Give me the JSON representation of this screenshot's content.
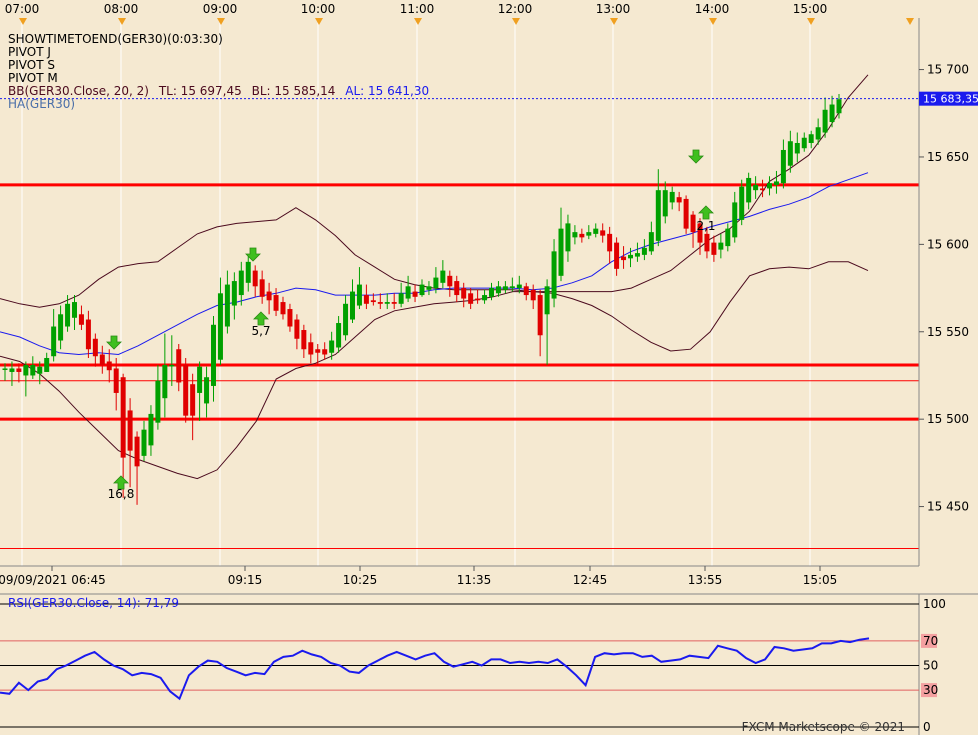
{
  "colors": {
    "background": "#f5e9d1",
    "bull": "#00a000",
    "bear": "#e00000",
    "bb_band": "#4b0a1e",
    "bb_mid": "#1a1aee",
    "pivot": "#ff0000",
    "rsi_line": "#1a1aee",
    "price_tag": "#1a1aee",
    "grid_time": "#ffffff",
    "arrow_green": "#3fbf1f"
  },
  "info_lines": [
    "SHOWTIMETOEND(GER30)(0:03:30)",
    "PIVOT J",
    "PIVOT S",
    "PIVOT M"
  ],
  "bb_legend": {
    "prefix": "BB(GER30.Close, 20, 2)",
    "tl_label": "TL: 15 697,45",
    "bl_label": "BL: 15 585,14",
    "al_label": "AL: 15 641,30"
  },
  "ha_label": "HA(GER30)",
  "last_price_label": "15 683,35",
  "watermark": "FXCM Marketscope © 2021",
  "chart_data": [
    {
      "type": "candlestick",
      "symbol": "GER30",
      "top_time_labels": [
        "07:00",
        "08:00",
        "09:00",
        "10:00",
        "11:00",
        "12:00",
        "13:00",
        "14:00",
        "15:00"
      ],
      "bottom_time_labels": [
        "09/09/2021 06:45",
        "09:15",
        "10:25",
        "11:35",
        "12:45",
        "13:55",
        "15:05"
      ],
      "y_ticks": [
        15700,
        15650,
        15600,
        15550,
        15500,
        15450
      ],
      "y_tick_labels": [
        "15 700",
        "15 650",
        "15 600",
        "15 550",
        "15 500",
        "15 450"
      ],
      "ylim": [
        15416.0,
        15729.5
      ],
      "last_price": 15683.35,
      "candles": [
        {
          "o": 15529,
          "c": 15529,
          "h": 15532,
          "l": 15522
        },
        {
          "o": 15527,
          "c": 15529,
          "h": 15533,
          "l": 15519
        },
        {
          "o": 15529,
          "c": 15527,
          "h": 15532,
          "l": 15521
        },
        {
          "o": 15525,
          "c": 15531,
          "h": 15533,
          "l": 15513
        },
        {
          "o": 15525,
          "c": 15531,
          "h": 15536,
          "l": 15523
        },
        {
          "o": 15526,
          "c": 15530,
          "h": 15533,
          "l": 15520
        },
        {
          "o": 15527,
          "c": 15535,
          "h": 15538,
          "l": 15527
        },
        {
          "o": 15536,
          "c": 15553,
          "h": 15563,
          "l": 15533
        },
        {
          "o": 15545,
          "c": 15560,
          "h": 15565,
          "l": 15540
        },
        {
          "o": 15553,
          "c": 15566,
          "h": 15571,
          "l": 15550
        },
        {
          "o": 15558,
          "c": 15567,
          "h": 15571,
          "l": 15551
        },
        {
          "o": 15560,
          "c": 15554,
          "h": 15565,
          "l": 15551
        },
        {
          "o": 15557,
          "c": 15540,
          "h": 15562,
          "l": 15535
        },
        {
          "o": 15546,
          "c": 15536,
          "h": 15549,
          "l": 15530
        },
        {
          "o": 15537,
          "c": 15531,
          "h": 15542,
          "l": 15526
        },
        {
          "o": 15533,
          "c": 15528,
          "h": 15540,
          "l": 15521
        },
        {
          "o": 15529,
          "c": 15515,
          "h": 15535,
          "l": 15505
        },
        {
          "o": 15524,
          "c": 15478,
          "h": 15526,
          "l": 15455
        },
        {
          "o": 15505,
          "c": 15482,
          "h": 15512,
          "l": 15461
        },
        {
          "o": 15490,
          "c": 15473,
          "h": 15493,
          "l": 15451
        },
        {
          "o": 15479,
          "c": 15494,
          "h": 15499,
          "l": 15476
        },
        {
          "o": 15485,
          "c": 15503,
          "h": 15508,
          "l": 15479
        },
        {
          "o": 15498,
          "c": 15522,
          "h": 15531,
          "l": 15494
        },
        {
          "o": 15512,
          "c": 15531,
          "h": 15549,
          "l": 15501
        },
        {
          "o": 15531,
          "c": 15531,
          "h": 15548,
          "l": 15519
        },
        {
          "o": 15540,
          "c": 15521,
          "h": 15543,
          "l": 15516
        },
        {
          "o": 15531,
          "c": 15502,
          "h": 15535,
          "l": 15498
        },
        {
          "o": 15520,
          "c": 15502,
          "h": 15526,
          "l": 15488
        },
        {
          "o": 15515,
          "c": 15530,
          "h": 15533,
          "l": 15499
        },
        {
          "o": 15509,
          "c": 15524,
          "h": 15530,
          "l": 15501
        },
        {
          "o": 15519,
          "c": 15554,
          "h": 15559,
          "l": 15510
        },
        {
          "o": 15534,
          "c": 15572,
          "h": 15581,
          "l": 15531
        },
        {
          "o": 15553,
          "c": 15577,
          "h": 15585,
          "l": 15549
        },
        {
          "o": 15565,
          "c": 15579,
          "h": 15584,
          "l": 15557
        },
        {
          "o": 15571,
          "c": 15585,
          "h": 15590,
          "l": 15565
        },
        {
          "o": 15578,
          "c": 15590,
          "h": 15594,
          "l": 15573
        },
        {
          "o": 15585,
          "c": 15576,
          "h": 15588,
          "l": 15570
        },
        {
          "o": 15580,
          "c": 15570,
          "h": 15585,
          "l": 15566
        },
        {
          "o": 15573,
          "c": 15568,
          "h": 15578,
          "l": 15560
        },
        {
          "o": 15571,
          "c": 15562,
          "h": 15575,
          "l": 15559
        },
        {
          "o": 15567,
          "c": 15560,
          "h": 15570,
          "l": 15557
        },
        {
          "o": 15563,
          "c": 15553,
          "h": 15566,
          "l": 15550
        },
        {
          "o": 15557,
          "c": 15546,
          "h": 15560,
          "l": 15540
        },
        {
          "o": 15551,
          "c": 15540,
          "h": 15554,
          "l": 15535
        },
        {
          "o": 15544,
          "c": 15537,
          "h": 15549,
          "l": 15532
        },
        {
          "o": 15540,
          "c": 15538,
          "h": 15543,
          "l": 15531
        },
        {
          "o": 15540,
          "c": 15537,
          "h": 15544,
          "l": 15534
        },
        {
          "o": 15538,
          "c": 15545,
          "h": 15550,
          "l": 15534
        },
        {
          "o": 15541,
          "c": 15555,
          "h": 15559,
          "l": 15538
        },
        {
          "o": 15548,
          "c": 15566,
          "h": 15571,
          "l": 15545
        },
        {
          "o": 15557,
          "c": 15573,
          "h": 15580,
          "l": 15555
        },
        {
          "o": 15565,
          "c": 15577,
          "h": 15587,
          "l": 15563
        },
        {
          "o": 15571,
          "c": 15566,
          "h": 15577,
          "l": 15563
        },
        {
          "o": 15568,
          "c": 15567,
          "h": 15572,
          "l": 15565
        },
        {
          "o": 15567,
          "c": 15566,
          "h": 15572,
          "l": 15563
        },
        {
          "o": 15566,
          "c": 15567,
          "h": 15572,
          "l": 15563
        },
        {
          "o": 15567,
          "c": 15566,
          "h": 15572,
          "l": 15563
        },
        {
          "o": 15566,
          "c": 15572,
          "h": 15578,
          "l": 15564
        },
        {
          "o": 15569,
          "c": 15576,
          "h": 15582,
          "l": 15567
        },
        {
          "o": 15573,
          "c": 15570,
          "h": 15577,
          "l": 15567
        },
        {
          "o": 15571,
          "c": 15577,
          "h": 15580,
          "l": 15570
        },
        {
          "o": 15574,
          "c": 15576,
          "h": 15579,
          "l": 15571
        },
        {
          "o": 15575,
          "c": 15581,
          "h": 15587,
          "l": 15572
        },
        {
          "o": 15578,
          "c": 15585,
          "h": 15591,
          "l": 15575
        },
        {
          "o": 15582,
          "c": 15576,
          "h": 15585,
          "l": 15570
        },
        {
          "o": 15579,
          "c": 15571,
          "h": 15582,
          "l": 15567
        },
        {
          "o": 15575,
          "c": 15569,
          "h": 15578,
          "l": 15564
        },
        {
          "o": 15572,
          "c": 15566,
          "h": 15575,
          "l": 15563
        },
        {
          "o": 15569,
          "c": 15568,
          "h": 15574,
          "l": 15566
        },
        {
          "o": 15568,
          "c": 15571,
          "h": 15574,
          "l": 15566
        },
        {
          "o": 15570,
          "c": 15575,
          "h": 15578,
          "l": 15568
        },
        {
          "o": 15572,
          "c": 15576,
          "h": 15579,
          "l": 15570
        },
        {
          "o": 15574,
          "c": 15576,
          "h": 15579,
          "l": 15572
        },
        {
          "o": 15575,
          "c": 15576,
          "h": 15581,
          "l": 15573
        },
        {
          "o": 15575,
          "c": 15577,
          "h": 15582,
          "l": 15572
        },
        {
          "o": 15576,
          "c": 15571,
          "h": 15578,
          "l": 15568
        },
        {
          "o": 15574,
          "c": 15568,
          "h": 15577,
          "l": 15563
        },
        {
          "o": 15571,
          "c": 15548,
          "h": 15574,
          "l": 15536
        },
        {
          "o": 15560,
          "c": 15576,
          "h": 15580,
          "l": 15531
        },
        {
          "o": 15569,
          "c": 15596,
          "h": 15603,
          "l": 15564
        },
        {
          "o": 15582,
          "c": 15609,
          "h": 15621,
          "l": 15579
        },
        {
          "o": 15596,
          "c": 15612,
          "h": 15617,
          "l": 15590
        },
        {
          "o": 15604,
          "c": 15607,
          "h": 15611,
          "l": 15600
        },
        {
          "o": 15606,
          "c": 15604,
          "h": 15609,
          "l": 15601
        },
        {
          "o": 15605,
          "c": 15607,
          "h": 15611,
          "l": 15603
        },
        {
          "o": 15606,
          "c": 15609,
          "h": 15612,
          "l": 15604
        },
        {
          "o": 15608,
          "c": 15605,
          "h": 15612,
          "l": 15601
        },
        {
          "o": 15606,
          "c": 15596,
          "h": 15610,
          "l": 15589
        },
        {
          "o": 15601,
          "c": 15586,
          "h": 15604,
          "l": 15582
        },
        {
          "o": 15593,
          "c": 15591,
          "h": 15599,
          "l": 15586
        },
        {
          "o": 15592,
          "c": 15594,
          "h": 15598,
          "l": 15587
        },
        {
          "o": 15593,
          "c": 15595,
          "h": 15601,
          "l": 15590
        },
        {
          "o": 15594,
          "c": 15598,
          "h": 15603,
          "l": 15591
        },
        {
          "o": 15596,
          "c": 15607,
          "h": 15613,
          "l": 15594
        },
        {
          "o": 15602,
          "c": 15631,
          "h": 15643,
          "l": 15599
        },
        {
          "o": 15616,
          "c": 15631,
          "h": 15636,
          "l": 15612
        },
        {
          "o": 15624,
          "c": 15630,
          "h": 15633,
          "l": 15620
        },
        {
          "o": 15627,
          "c": 15624,
          "h": 15630,
          "l": 15619
        },
        {
          "o": 15626,
          "c": 15609,
          "h": 15628,
          "l": 15606
        },
        {
          "o": 15617,
          "c": 15607,
          "h": 15619,
          "l": 15598
        },
        {
          "o": 15612,
          "c": 15601,
          "h": 15615,
          "l": 15594
        },
        {
          "o": 15606,
          "c": 15596,
          "h": 15610,
          "l": 15592
        },
        {
          "o": 15601,
          "c": 15594,
          "h": 15605,
          "l": 15590
        },
        {
          "o": 15597,
          "c": 15601,
          "h": 15606,
          "l": 15592
        },
        {
          "o": 15599,
          "c": 15609,
          "h": 15612,
          "l": 15596
        },
        {
          "o": 15604,
          "c": 15624,
          "h": 15630,
          "l": 15601
        },
        {
          "o": 15614,
          "c": 15633,
          "h": 15637,
          "l": 15611
        },
        {
          "o": 15624,
          "c": 15638,
          "h": 15641,
          "l": 15620
        },
        {
          "o": 15631,
          "c": 15634,
          "h": 15639,
          "l": 15626
        },
        {
          "o": 15632,
          "c": 15631,
          "h": 15637,
          "l": 15627
        },
        {
          "o": 15632,
          "c": 15635,
          "h": 15639,
          "l": 15628
        },
        {
          "o": 15634,
          "c": 15636,
          "h": 15642,
          "l": 15629
        },
        {
          "o": 15635,
          "c": 15654,
          "h": 15660,
          "l": 15632
        },
        {
          "o": 15645,
          "c": 15659,
          "h": 15665,
          "l": 15641
        },
        {
          "o": 15652,
          "c": 15658,
          "h": 15664,
          "l": 15647
        },
        {
          "o": 15655,
          "c": 15661,
          "h": 15664,
          "l": 15653
        },
        {
          "o": 15658,
          "c": 15663,
          "h": 15665,
          "l": 15655
        },
        {
          "o": 15660,
          "c": 15667,
          "h": 15672,
          "l": 15657
        },
        {
          "o": 15664,
          "c": 15677,
          "h": 15684,
          "l": 15661
        },
        {
          "o": 15670,
          "c": 15680,
          "h": 15685,
          "l": 15667
        },
        {
          "o": 15675,
          "c": 15683,
          "h": 15686,
          "l": 15672
        }
      ],
      "bb_upper": [
        15569,
        15566,
        15564,
        15566,
        15571,
        15580,
        15587,
        15589,
        15590,
        15598,
        15606,
        15610,
        15612,
        15613,
        15614,
        15621,
        15614,
        15605,
        15594,
        15587,
        15580,
        15577,
        15575,
        15574,
        15574,
        15574,
        15574,
        15573,
        15573,
        15573,
        15573,
        15573,
        15575,
        15580,
        15585,
        15594,
        15603,
        15609,
        15619,
        15636,
        15643,
        15651,
        15666,
        15684,
        15697
      ],
      "bb_middle": [
        15550,
        15547,
        15542,
        15538,
        15537,
        15538,
        15537,
        15542,
        15548,
        15554,
        15560,
        15565,
        15567,
        15570,
        15572,
        15575,
        15574,
        15571,
        15571,
        15571,
        15572,
        15572,
        15574,
        15575,
        15575,
        15575,
        15575,
        15574,
        15575,
        15578,
        15582,
        15590,
        15596,
        15600,
        15603,
        15606,
        15610,
        15613,
        15616,
        15620,
        15623,
        15627,
        15633,
        15637,
        15641
      ],
      "bb_lower": [
        15536,
        15533,
        15526,
        15516,
        15504,
        15493,
        15482,
        15477,
        15473,
        15469,
        15466,
        15471,
        15484,
        15499,
        15523,
        15529,
        15532,
        15537,
        15547,
        15557,
        15562,
        15564,
        15566,
        15567,
        15568,
        15570,
        15573,
        15573,
        15572,
        15569,
        15565,
        15559,
        15551,
        15544,
        15539,
        15540,
        15550,
        15567,
        15582,
        15586,
        15587,
        15586,
        15590,
        15590,
        15585
      ],
      "pivot_levels": [
        15634,
        15531,
        15500
      ],
      "thin_levels": [
        15522,
        15426
      ],
      "markers": [
        {
          "type": "buy",
          "label": "16,8"
        },
        {
          "type": "sell",
          "label": ""
        },
        {
          "type": "sell",
          "label": ""
        },
        {
          "type": "buy",
          "label": "5,7"
        },
        {
          "type": "sell",
          "label": ""
        },
        {
          "type": "buy",
          "label": "2,1"
        }
      ]
    },
    {
      "type": "line",
      "title": "RSI(GER30.Close, 14): 71,79",
      "ylim": [
        0,
        100
      ],
      "y_ticks": [
        100,
        70,
        50,
        30,
        0
      ],
      "y_tick_labels": [
        "100",
        "70",
        "50",
        "30",
        "0"
      ],
      "levels": [
        100,
        70,
        50,
        30,
        0
      ],
      "values": [
        28,
        27,
        36,
        30,
        37,
        39,
        47,
        50,
        54,
        58,
        61,
        55,
        50,
        47,
        42,
        44,
        43,
        40,
        29,
        23,
        42,
        49,
        54,
        53,
        48,
        45,
        42,
        44,
        43,
        53,
        57,
        58,
        62,
        59,
        57,
        52,
        50,
        45,
        44,
        50,
        54,
        58,
        61,
        58,
        55,
        58,
        60,
        53,
        49,
        51,
        53,
        50,
        55,
        55,
        52,
        53,
        52,
        53,
        52,
        55,
        49,
        42,
        34,
        57,
        60,
        59,
        60,
        60,
        57,
        58,
        53,
        54,
        55,
        58,
        57,
        56,
        66,
        64,
        62,
        56,
        52,
        55,
        65,
        64,
        62,
        63,
        64,
        68,
        68,
        70,
        69,
        71,
        72
      ]
    }
  ]
}
